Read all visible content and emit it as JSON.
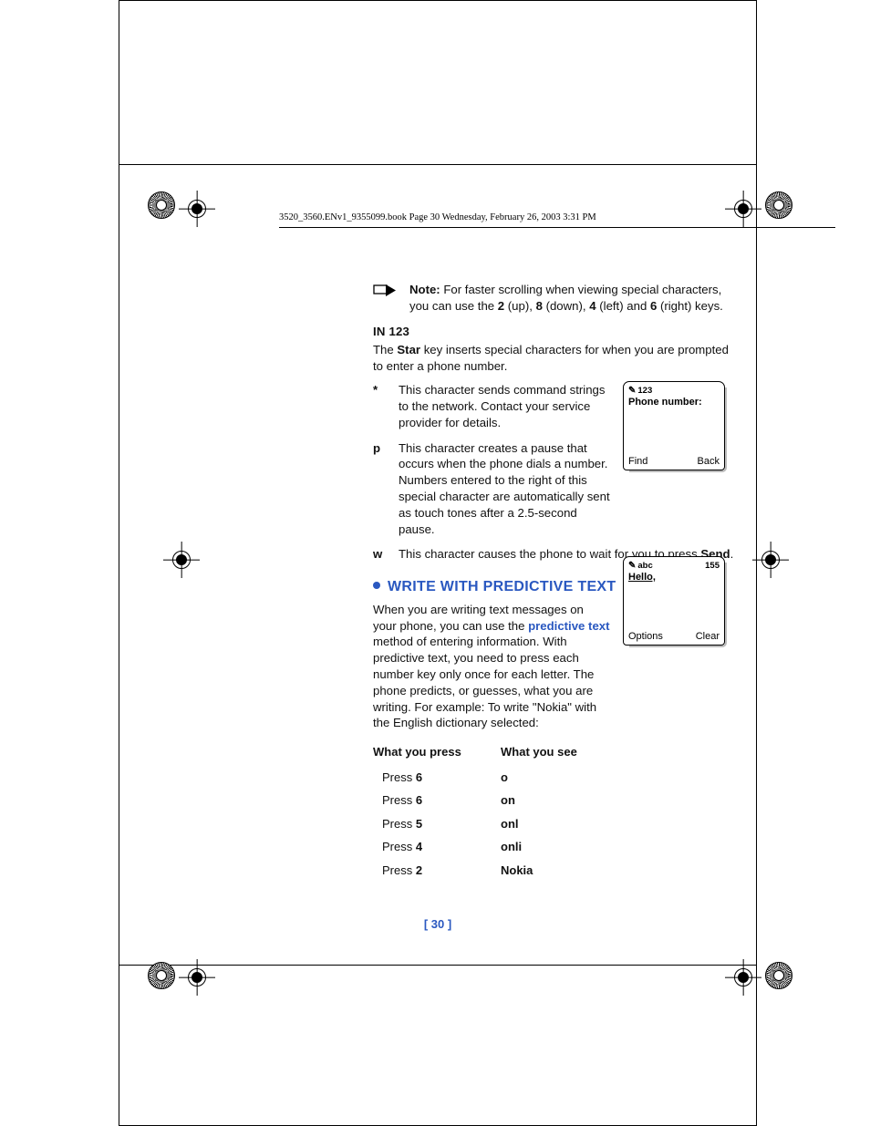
{
  "header": {
    "text": "3520_3560.ENv1_9355099.book  Page 30  Wednesday, February 26, 2003  3:31 PM"
  },
  "note": {
    "label": "Note:",
    "body_a": " For faster scrolling when viewing special characters, you can use the ",
    "k1": "2",
    "d1": " (up), ",
    "k2": "8",
    "d2": " (down), ",
    "k3": "4",
    "d3": " (left) and ",
    "k4": "6",
    "d4": " (right) keys."
  },
  "in123": {
    "heading": "IN 123",
    "intro_a": "The ",
    "intro_b": "Star",
    "intro_c": " key inserts special characters for when you are prompted to enter a phone number.",
    "items": [
      {
        "key": "*",
        "body": "This character sends command strings to the network. Contact your service provider for details."
      },
      {
        "key": "p",
        "body": "This character creates a pause that occurs when the phone dials a number. Numbers entered to the right of this special character are automatically sent as touch tones after a 2.5-second pause."
      },
      {
        "key": "w",
        "body_a": "This character causes the phone to wait for you to press ",
        "body_b": "Send",
        "body_c": "."
      }
    ]
  },
  "screen1": {
    "mode": "123",
    "title": "Phone number:",
    "sk_left": "Find",
    "sk_right": "Back"
  },
  "predictive": {
    "heading": "WRITE WITH PREDICTIVE TEXT",
    "p_a": "When you are writing text messages on your phone, you can use the ",
    "p_link": "predictive text",
    "p_b": " method of entering information. With predictive text, you need to press each number key only once for each letter. The phone predicts, or guesses, what you are writing. For example: To write \"Nokia\" with the English dictionary selected:"
  },
  "screen2": {
    "mode": "abc",
    "count": "155",
    "title": "Hello,",
    "sk_left": "Options",
    "sk_right": "Clear"
  },
  "table": {
    "h1": "What you press",
    "h2": "What you see",
    "rows": [
      {
        "press_a": "Press ",
        "press_b": "6",
        "see": "o"
      },
      {
        "press_a": "Press ",
        "press_b": "6",
        "see": "on"
      },
      {
        "press_a": "Press ",
        "press_b": "5",
        "see": "onl"
      },
      {
        "press_a": "Press ",
        "press_b": "4",
        "see": "onli"
      },
      {
        "press_a": "Press ",
        "press_b": "2",
        "see": "Nokia"
      }
    ]
  },
  "page_number": "[ 30 ]"
}
